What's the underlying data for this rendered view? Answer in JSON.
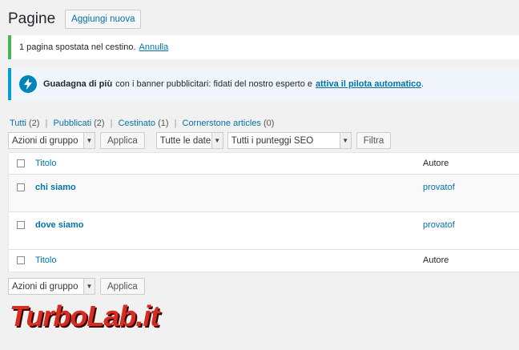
{
  "header": {
    "title": "Pagine",
    "add_new_label": "Aggiungi nuova"
  },
  "notice_success": {
    "text": "1 pagina spostata nel cestino.",
    "undo_link": "Annulla"
  },
  "notice_info": {
    "icon": "bolt-icon",
    "bold": "Guadagna di più",
    "text": "con i banner pubblicitari: fidati del nostro esperto e",
    "link": "attiva il pilota automatico",
    "end": "."
  },
  "filters": [
    {
      "label": "Tutti",
      "count": "(2)"
    },
    {
      "label": "Pubblicati",
      "count": "(2)"
    },
    {
      "label": "Cestinato",
      "count": "(1)"
    },
    {
      "label": "Cornerstone articles",
      "count": "(0)"
    }
  ],
  "separator": "|",
  "tablenav_top": {
    "bulk_select": "Azioni di gruppo",
    "apply_label": "Applica",
    "date_select": "Tutte le date",
    "seo_select": "Tutti i punteggi SEO",
    "filter_label": "Filtra"
  },
  "table": {
    "header": {
      "title": "Titolo",
      "author": "Autore"
    },
    "rows": [
      {
        "title": "chi siamo",
        "author": "provatof"
      },
      {
        "title": "dove siamo",
        "author": "provatof"
      }
    ],
    "footer": {
      "title": "Titolo",
      "author": "Autore"
    }
  },
  "tablenav_bottom": {
    "bulk_select": "Azioni di gruppo",
    "apply_label": "Applica"
  },
  "watermark": {
    "left": "Turbo",
    "right": "Lab.it"
  },
  "colors": {
    "accent": "#0073aa",
    "success": "#46b450",
    "info": "#00a0d2",
    "brand_red": "#d62d20"
  }
}
